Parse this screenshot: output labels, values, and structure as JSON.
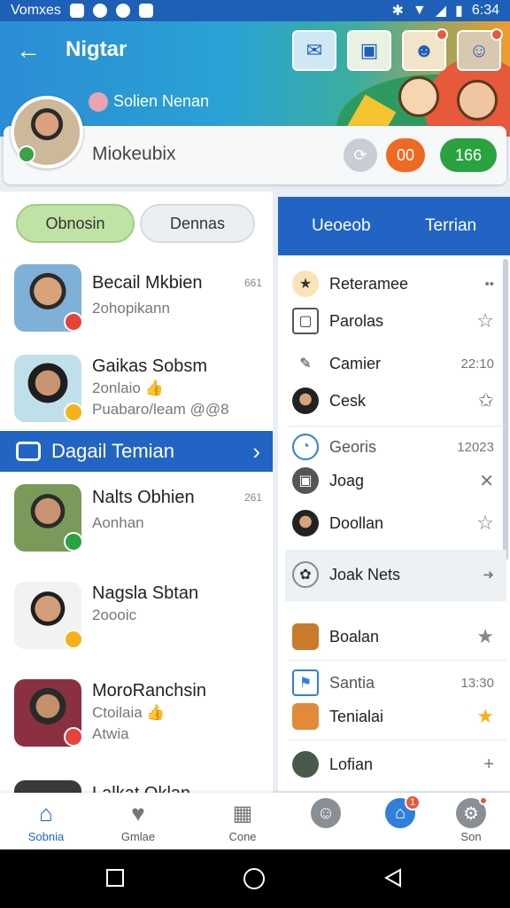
{
  "status_bar": {
    "carrier": "Vomxes",
    "time": "6:34"
  },
  "header": {
    "title": "Nigtar",
    "subtitle": "Solien Nenan"
  },
  "profile": {
    "name": "Miokeubix",
    "btn_orange": "00",
    "btn_green": "166"
  },
  "left_tabs": {
    "first": "Obnosin",
    "second": "Dennas"
  },
  "chats": [
    {
      "name": "Becail Mkbien",
      "sub": "2ohopikann",
      "sub2": "",
      "time": "661"
    },
    {
      "name": "Gaikas Sobsm",
      "sub": "2onlaio 👍",
      "sub2": "Puabaro/leam @@8",
      "time": ""
    },
    {
      "name": "Nalts Obhien",
      "sub": "Aonhan",
      "sub2": "",
      "time": "261"
    },
    {
      "name": "Nagsla Sbtan",
      "sub": "2oooic",
      "sub2": "",
      "time": ""
    },
    {
      "name": "MoroRanchsin",
      "sub": "Ctoilaia 👍",
      "sub2": "Atwia",
      "time": ""
    },
    {
      "name": "Lalkat Oklan",
      "sub": "",
      "sub2": "",
      "time": ""
    }
  ],
  "banner": {
    "label": "Dagail Temian"
  },
  "right_tabs": {
    "first": "Ueoeob",
    "second": "Terrian"
  },
  "right_items": [
    {
      "label": "Reteramee",
      "meta": "••"
    },
    {
      "label": "Parolas",
      "meta": "☆"
    },
    {
      "label": "Camier",
      "meta": "22:10"
    },
    {
      "label": "Cesk",
      "meta": "✩"
    },
    {
      "label": "Georis",
      "meta": "12023"
    },
    {
      "label": "Joag",
      "meta": "✕"
    },
    {
      "label": "Doollan",
      "meta": "☆"
    },
    {
      "label": "Joak Nets",
      "meta": "➜"
    },
    {
      "label": "Boalan",
      "meta": "★"
    },
    {
      "label": "Santia",
      "meta": "13:30"
    },
    {
      "label": "Tenialai",
      "meta": "★"
    },
    {
      "label": "Lofian",
      "meta": "+"
    }
  ],
  "bottom_nav": [
    {
      "label": "Sobnia",
      "badge": ""
    },
    {
      "label": "Gmlae",
      "badge": ""
    },
    {
      "label": "Cone",
      "badge": ""
    },
    {
      "label": "",
      "badge": ""
    },
    {
      "label": "",
      "badge": "1"
    },
    {
      "label": "Son",
      "badge": ""
    }
  ],
  "colors": {
    "primary": "#2264c4",
    "orange": "#ee6a22",
    "green": "#2aa240",
    "star": "#f5b21a"
  }
}
